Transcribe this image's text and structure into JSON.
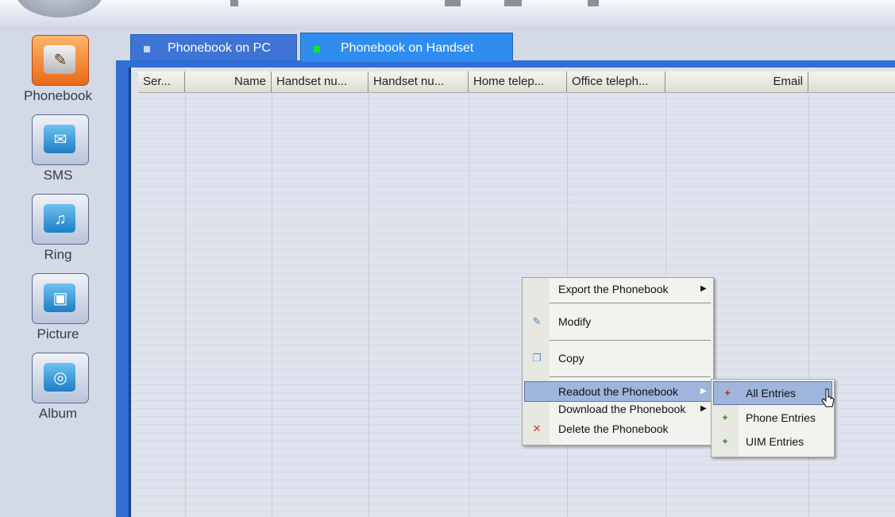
{
  "sidebar": {
    "items": [
      {
        "label": "Phonebook",
        "icon": "phonebook-icon",
        "glyph": "✎"
      },
      {
        "label": "SMS",
        "icon": "sms-icon",
        "glyph": "✉"
      },
      {
        "label": "Ring",
        "icon": "ring-icon",
        "glyph": "♫"
      },
      {
        "label": "Picture",
        "icon": "picture-icon",
        "glyph": "▣"
      },
      {
        "label": "Album",
        "icon": "album-icon",
        "glyph": "◎"
      }
    ]
  },
  "tabs": [
    {
      "label": "Phonebook on PC",
      "marker_color": "#c8d4f0"
    },
    {
      "label": "Phonebook on Handset",
      "marker_color": "#19e619"
    }
  ],
  "table": {
    "columns": [
      "Ser...",
      "Name",
      "Handset nu...",
      "Handset nu...",
      "Home telep...",
      "Office teleph...",
      "Email"
    ]
  },
  "context_menu": {
    "items": [
      {
        "label": "Export the Phonebook",
        "submenu_arrow": "▶"
      },
      {
        "label": "Modify",
        "icon": "modify-icon"
      },
      {
        "label": "Copy",
        "icon": "copy-icon"
      },
      {
        "label": "Readout the Phonebook",
        "submenu_arrow": "▶"
      },
      {
        "label": "Download the Phonebook",
        "submenu_arrow": "▶"
      },
      {
        "label": "Delete the Phonebook",
        "icon": "delete-icon"
      }
    ]
  },
  "submenu": {
    "items": [
      {
        "label": "All Entries",
        "icon": "all-entries-icon"
      },
      {
        "label": "Phone Entries",
        "icon": "phone-entries-icon"
      },
      {
        "label": "UIM Entries",
        "icon": "uim-entries-icon"
      }
    ]
  },
  "colors": {
    "accent_blue": "#2f6fd6",
    "active_tab": "#2f8df0",
    "menu_highlight": "#9fb5dc",
    "active_nav_orange": "#e86a18"
  }
}
